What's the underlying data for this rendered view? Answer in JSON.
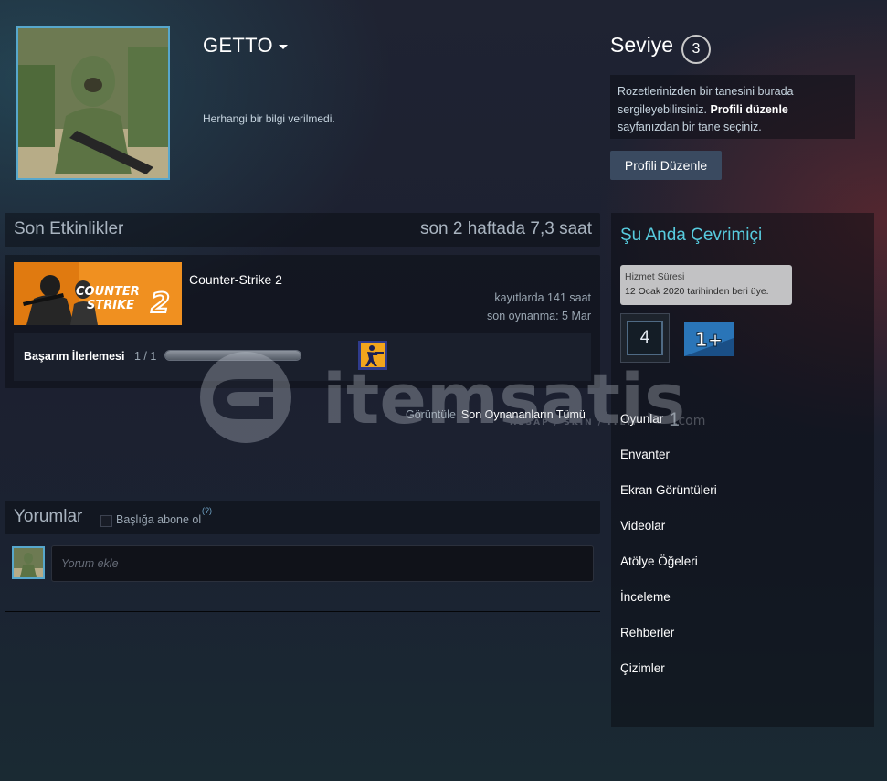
{
  "profile": {
    "persona_name": "GETTO",
    "summary": "Herhangi bir bilgi verilmedi."
  },
  "level": {
    "label": "Seviye",
    "value": "3"
  },
  "badge_info": {
    "text_before": "Rozetlerinizden bir tanesini burada sergileyebilirsiniz. ",
    "link": "Profili düzenle",
    "text_after": " sayfanızdan bir tane seçiniz."
  },
  "edit_profile_button": "Profili Düzenle",
  "recent_activity": {
    "title": "Son Etkinlikler",
    "playtime": "son 2 haftada 7,3 saat",
    "game": {
      "capsule_text_line1": "COUNTER",
      "capsule_text_line2": "STRIKE",
      "capsule_number": "2",
      "name": "Counter-Strike 2",
      "hours_on_record": "kayıtlarda 141 saat",
      "last_played": "son oynanma: 5 Mar",
      "achievement_label": "Başarım İlerlemesi",
      "achievement_count": "1 / 1",
      "achievement_progress": 1.0
    },
    "view_label": "Görüntüle",
    "view_all_link": "Son Oynananların Tümü"
  },
  "comments": {
    "title": "Yorumlar",
    "subscribe_label": "Başlığa abone ol",
    "help_mark": "(?)",
    "input_placeholder": "Yorum ekle"
  },
  "sidebar": {
    "online_status": "Şu Anda Çevrimiçi",
    "service_badge": {
      "title": "Hizmet Süresi",
      "date": "12 Ocak 2020 tarihinden beri üye."
    },
    "years_badge": "4",
    "plus_badge": "1+",
    "nav": [
      {
        "label": "Oyunlar",
        "count": "1"
      },
      {
        "label": "Envanter"
      },
      {
        "label": "Ekran Görüntüleri"
      },
      {
        "label": "Videolar"
      },
      {
        "label": "Atölye Öğeleri"
      },
      {
        "label": "İnceleme"
      },
      {
        "label": "Rehberler"
      },
      {
        "label": "Çizimler"
      }
    ]
  },
  "watermark": {
    "brand": "itemsatis",
    "tagline": "HESAP / SKIN / ITEM",
    "suffix": ".com"
  },
  "colors": {
    "online": "#57cbde",
    "avatar_border": "#57a7cc",
    "capsule_orange": "#f09020",
    "button": "#3a4a60"
  }
}
